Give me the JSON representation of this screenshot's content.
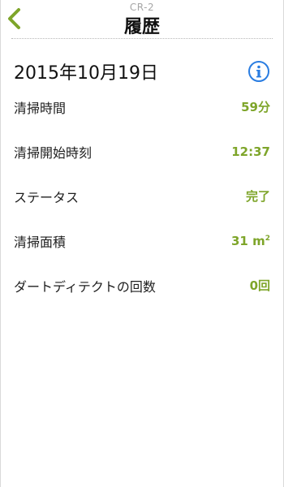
{
  "header": {
    "model": "CR-2",
    "title": "履歴"
  },
  "date": "2015年10月19日",
  "rows": [
    {
      "label": "清掃時間",
      "value": "59分"
    },
    {
      "label": "清掃開始時刻",
      "value": "12:37"
    },
    {
      "label": "ステータス",
      "value": "完了"
    },
    {
      "label": "清掃面積",
      "value": "31 m",
      "unit_sup": "2"
    },
    {
      "label": "ダートディテクトの回数",
      "value": "0回"
    }
  ],
  "colors": {
    "accent_green": "#7ea52a",
    "info_blue": "#2a7de1"
  },
  "icons": {
    "back": "chevron-left-icon",
    "info": "info-icon"
  }
}
